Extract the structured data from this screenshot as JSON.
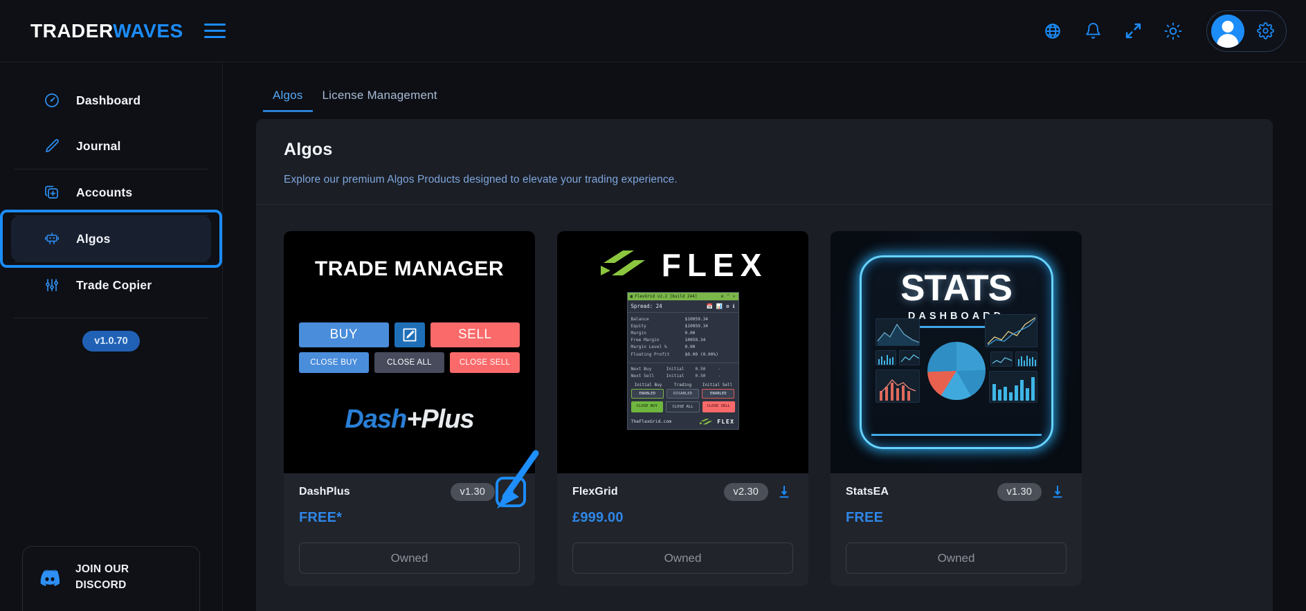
{
  "app": {
    "brand_part1": "TRADER",
    "brand_part2": "WAVES",
    "menu_icon": "hamburger-icon"
  },
  "topbar": {
    "icons": [
      {
        "name": "globe-icon",
        "label": "Language"
      },
      {
        "name": "bell-icon",
        "label": "Notifications"
      },
      {
        "name": "fullscreen-icon",
        "label": "Fullscreen"
      },
      {
        "name": "sun-icon",
        "label": "Theme"
      }
    ],
    "avatar_label": "User",
    "gear_label": "Settings"
  },
  "sidebar": {
    "items": [
      {
        "label": "Dashboard",
        "icon": "speedometer-icon",
        "active": false
      },
      {
        "label": "Journal",
        "icon": "pencil-icon",
        "active": false
      },
      {
        "label": "Accounts",
        "icon": "add-card-icon",
        "active": false
      },
      {
        "label": "Algos",
        "icon": "robot-icon",
        "active": true
      },
      {
        "label": "Trade Copier",
        "icon": "sliders-icon",
        "active": false
      }
    ],
    "version": "v1.0.70",
    "discord": {
      "line1": "JOIN OUR",
      "line2": "DISCORD",
      "icon": "discord-icon"
    }
  },
  "tabs": [
    {
      "label": "Algos",
      "active": true
    },
    {
      "label": "License Management",
      "active": false
    }
  ],
  "panel": {
    "title": "Algos",
    "subtitle": "Explore our premium Algos Products designed to elevate your trading experience."
  },
  "colors": {
    "accent": "#1c8cf8",
    "price": "#2f87e8",
    "highlight_box": "#1c8cf8",
    "tab_active": "#56a9f5",
    "version_badge_bg": "#2161b5"
  },
  "products": [
    {
      "name": "DashPlus",
      "version": "v1.30",
      "price": "FREE*",
      "action_label": "Owned",
      "download_icon": "download-icon",
      "download_highlighted": true,
      "art": {
        "kind": "trade-manager",
        "title": "TRADE MANAGER",
        "buttons_row1": [
          "BUY",
          "edit-icon",
          "SELL"
        ],
        "buy_label": "BUY",
        "sell_label": "SELL",
        "buttons_row2": [
          "CLOSE BUY",
          "CLOSE ALL",
          "CLOSE SELL"
        ],
        "logo_part1": "Dash",
        "logo_part2": "+Plus"
      }
    },
    {
      "name": "FlexGrid",
      "version": "v2.30",
      "price": "£999.00",
      "action_label": "Owned",
      "download_icon": "download-icon",
      "download_highlighted": false,
      "art": {
        "kind": "flex",
        "wordmark": "FLEX",
        "panel": {
          "titlebar": "FlexGrid v2.2 [build 244]",
          "spread": "Spread: 24",
          "rows": [
            {
              "k": "Balance",
              "v": "$10059.34"
            },
            {
              "k": "Equity",
              "v": "$10059.34"
            },
            {
              "k": "Margin",
              "v": "0.00"
            },
            {
              "k": "Free Margin",
              "v": "10059.34"
            },
            {
              "k": "Margin Level %",
              "v": "0.00"
            },
            {
              "k": "Floating Profit",
              "v": "$0.00 (0.00%)"
            }
          ],
          "next_rows": [
            {
              "a": "Next Buy",
              "b": "Initial",
              "c": "0.50",
              "d": "-"
            },
            {
              "a": "Next Sell",
              "b": "Initial",
              "c": "0.50",
              "d": "-"
            }
          ],
          "col_labels": [
            "Initial Buy",
            "Trading",
            "Initial Sell"
          ],
          "states": [
            "ENABLED",
            "DISABLED",
            "ENABLED"
          ],
          "actions": [
            "CLOSE BUY",
            "CLOSE ALL",
            "CLOSE SELL"
          ],
          "footer": "TheFlexGrid.com",
          "footer_brand": "FLEX"
        }
      }
    },
    {
      "name": "StatsEA",
      "version": "v1.30",
      "price": "FREE",
      "action_label": "Owned",
      "download_icon": "download-icon",
      "download_highlighted": false,
      "art": {
        "kind": "stats",
        "title": "STATS",
        "subtitle": "DASHBOARD"
      }
    }
  ],
  "annotation": {
    "arrow": "blue-arrow-pointing-to-download-button",
    "target": "DashPlus download button"
  }
}
